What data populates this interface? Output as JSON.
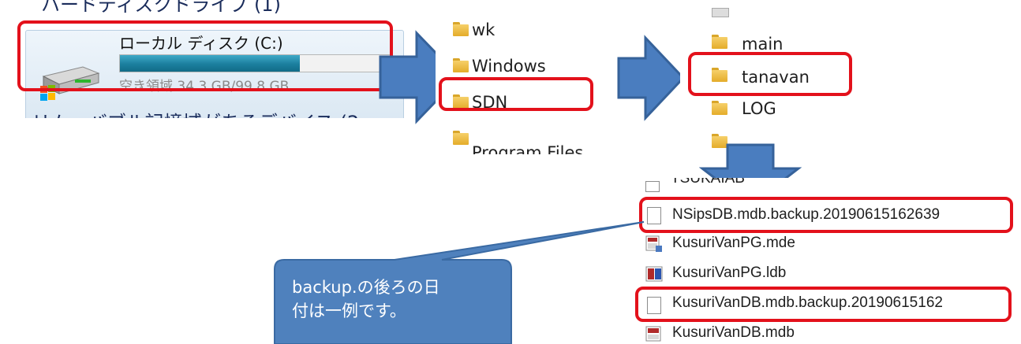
{
  "explorer_drives": {
    "top_cut_heading": "ハードディスクドライブ (1)",
    "drive": {
      "name": "ローカル ディスク (C:)",
      "usage_fraction": 0.66,
      "free_text": "空き領域 34.3 GB/99.8 GB"
    },
    "bottom_cut_heading": "リムーバブル記憶域があるデバイス (2"
  },
  "folder_list_1": {
    "items": [
      "wk",
      "Windows",
      "SDN",
      "Program Files"
    ],
    "highlighted": "SDN"
  },
  "folder_list_2": {
    "items": [
      "main",
      "tanavan",
      "LOG"
    ],
    "highlighted": "tanavan"
  },
  "file_list": {
    "top_cut_item": "TSUKAIAB",
    "items": [
      {
        "name": "NSipsDB.mdb.backup.20190615162639",
        "icon": "blank-file-icon",
        "highlighted": true
      },
      {
        "name": "KusuriVanPG.mde",
        "icon": "access-mde-icon",
        "highlighted": false
      },
      {
        "name": "KusuriVanPG.ldb",
        "icon": "access-ldb-icon",
        "highlighted": false
      },
      {
        "name": "KusuriVanDB.mdb.backup.20190615162",
        "icon": "blank-file-icon",
        "highlighted": true
      },
      {
        "name": "KusuriVanDB.mdb",
        "icon": "access-mdb-icon",
        "highlighted": false
      }
    ]
  },
  "callout": {
    "text_line1": "backup.の後ろの日",
    "text_line2": "付は一例です。"
  },
  "colors": {
    "arrow_fill": "#4a7dbf",
    "arrow_stroke": "#36629a",
    "highlight": "#e3111b",
    "callout_fill": "#4f81bd"
  }
}
